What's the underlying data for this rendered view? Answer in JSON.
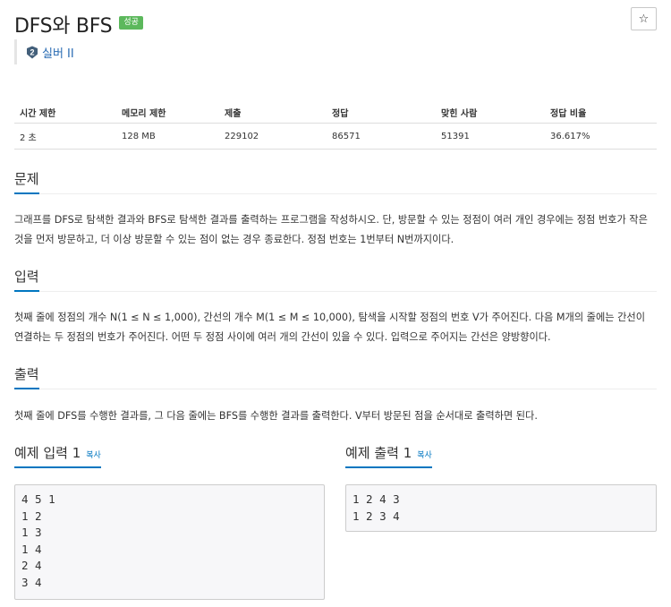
{
  "problem": {
    "title": "DFS와 BFS",
    "status_badge": "성공",
    "star_icon": "☆",
    "tier": {
      "number": "2",
      "label": "실버 II"
    }
  },
  "info_table": {
    "headers": [
      "시간 제한",
      "메모리 제한",
      "제출",
      "정답",
      "맞힌 사람",
      "정답 비율"
    ],
    "values": [
      "2 초",
      "128 MB",
      "229102",
      "86571",
      "51391",
      "36.617%"
    ]
  },
  "sections": {
    "problem": {
      "heading": "문제",
      "text": "그래프를 DFS로 탐색한 결과와 BFS로 탐색한 결과를 출력하는 프로그램을 작성하시오. 단, 방문할 수 있는 정점이 여러 개인 경우에는 정점 번호가 작은 것을 먼저 방문하고, 더 이상 방문할 수 있는 점이 없는 경우 종료한다. 정점 번호는 1번부터 N번까지이다."
    },
    "input": {
      "heading": "입력",
      "text": "첫째 줄에 정점의 개수 N(1 ≤ N ≤ 1,000), 간선의 개수 M(1 ≤ M ≤ 10,000), 탐색을 시작할 정점의 번호 V가 주어진다. 다음 M개의 줄에는 간선이 연결하는 두 정점의 번호가 주어진다. 어떤 두 정점 사이에 여러 개의 간선이 있을 수 있다. 입력으로 주어지는 간선은 양방향이다."
    },
    "output": {
      "heading": "출력",
      "text": "첫째 줄에 DFS를 수행한 결과를, 그 다음 줄에는 BFS를 수행한 결과를 출력한다. V부터 방문된 점을 순서대로 출력하면 된다."
    }
  },
  "samples": {
    "input": {
      "heading": "예제 입력 1",
      "copy_label": "복사",
      "content": "4 5 1\n1 2\n1 3\n1 4\n2 4\n3 4"
    },
    "output": {
      "heading": "예제 출력 1",
      "copy_label": "복사",
      "content": "1 2 4 3\n1 2 3 4"
    }
  },
  "colors": {
    "accent": "#0076c0",
    "success": "#5cb85c",
    "tier_silver": "#435f7a"
  }
}
